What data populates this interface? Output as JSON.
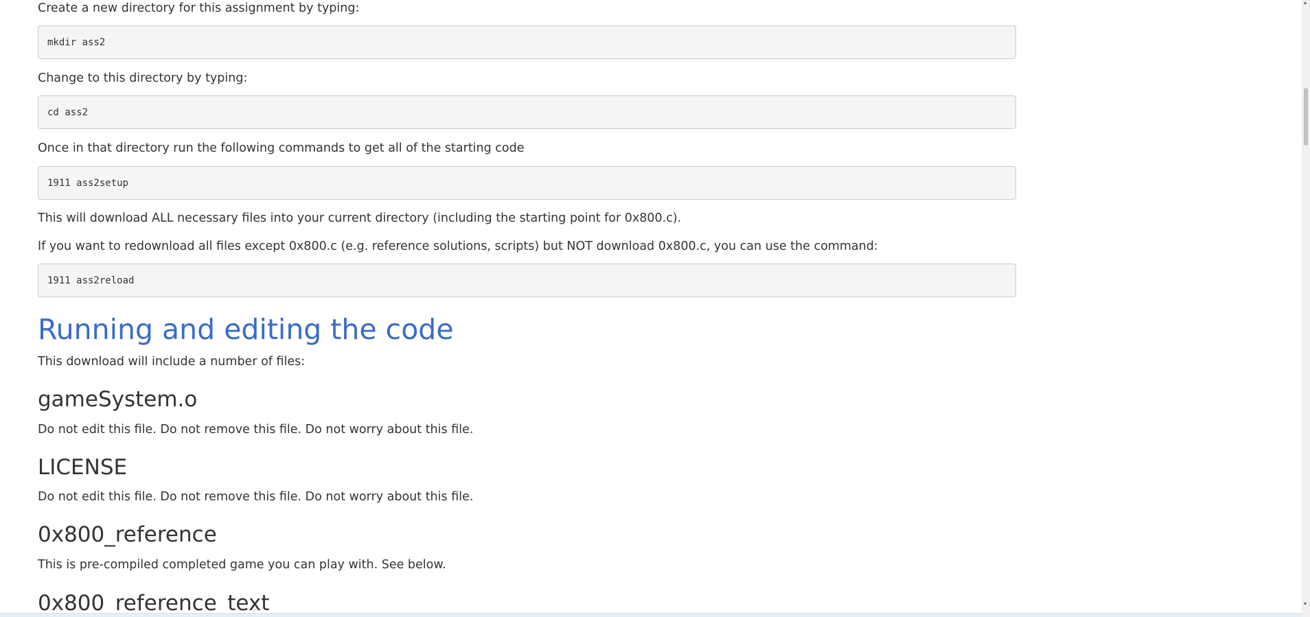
{
  "content": {
    "p_mkdir_intro": "Create a new directory for this assignment by typing:",
    "code_mkdir": "mkdir ass2",
    "p_cd_intro": "Change to this directory by typing:",
    "code_cd": "cd ass2",
    "p_commands_intro": "Once in that directory run the following commands to get all of the starting code",
    "code_setup": "1911 ass2setup",
    "p_download_all": "This will download ALL necessary files into your current directory (including the starting point for 0x800.c).",
    "p_redownload": "If you want to redownload all files except 0x800.c (e.g. reference solutions, scripts) but NOT download 0x800.c, you can use the command:",
    "code_reload": "1911 ass2reload",
    "heading_running": "Running and editing the code",
    "p_download_includes": "This download will include a number of files:",
    "heading_gamesystem": "gameSystem.o",
    "p_gamesystem": "Do not edit this file. Do not remove this file. Do not worry about this file.",
    "heading_license": "LICENSE",
    "p_license": "Do not edit this file. Do not remove this file. Do not worry about this file.",
    "heading_reference": "0x800_reference",
    "p_reference": "This is pre-compiled completed game you can play with. See below.",
    "heading_reference_text": "0x800_reference_text"
  },
  "colors": {
    "heading_link": "#3b6bc8",
    "body_text": "#333333",
    "code_background": "#f5f5f5",
    "code_border": "#cccccc"
  },
  "scrollbar": {
    "up_arrow_icon": "scroll-up-arrow",
    "down_arrow_icon": "scroll-down-arrow"
  }
}
